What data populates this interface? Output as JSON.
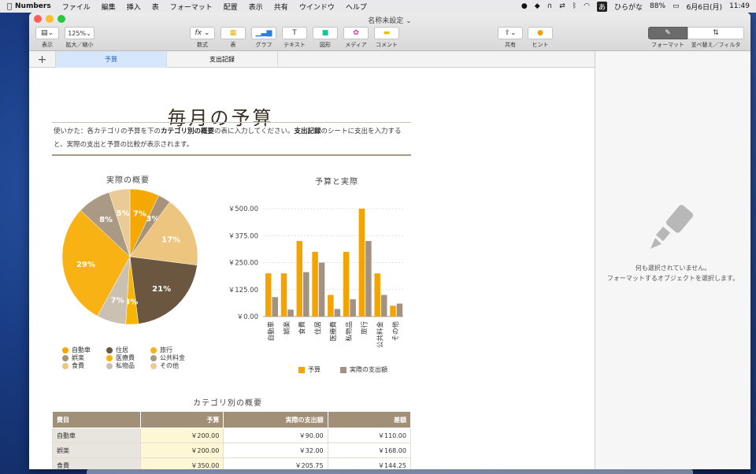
{
  "menubar": {
    "app": "Numbers",
    "items": [
      "ファイル",
      "編集",
      "挿入",
      "表",
      "フォーマット",
      "配置",
      "表示",
      "共有",
      "ウインドウ",
      "ヘルプ"
    ],
    "input_mode": "ひらがな",
    "battery": "88%",
    "date": "6月6日(月)",
    "time": "11:49"
  },
  "window": {
    "title": "名称未設定",
    "toolbar": {
      "view_label": "表示",
      "zoom_value": "125%",
      "zoom_label": "拡大／縮小",
      "formula_label": "数式",
      "table_label": "表",
      "chart_label": "グラフ",
      "text_label": "テキスト",
      "shape_label": "図形",
      "media_label": "メディア",
      "comment_label": "コメント",
      "share_label": "共有",
      "hint_label": "ヒント",
      "format_label": "フォーマット",
      "sort_label": "並べ替え／フィルタ"
    },
    "tabs": [
      "予算",
      "支出記録"
    ],
    "active_tab": "予算"
  },
  "sheet": {
    "title": "毎月の予算",
    "intro_1": "使いかた：各カテゴリの予算を下の",
    "intro_2": "カテゴリ別の概要",
    "intro_3": "の表に入力してください。",
    "intro_4": "支出記録",
    "intro_5": "のシートに支出を入力すると、実際の支出と予算の比較が表示されます。",
    "table_title": "カテゴリ別の概要",
    "table_headers": [
      "費目",
      "予算",
      "実際の支出額",
      "差額"
    ],
    "rows": [
      {
        "cat": "自動車",
        "budget": "￥200.00",
        "actual": "￥90.00",
        "diff": "￥110.00"
      },
      {
        "cat": "娯楽",
        "budget": "￥200.00",
        "actual": "￥32.00",
        "diff": "￥168.00"
      },
      {
        "cat": "食費",
        "budget": "￥350.00",
        "actual": "￥205.75",
        "diff": "￥144.25"
      }
    ]
  },
  "chart_data": [
    {
      "type": "pie",
      "title": "実際の概要",
      "categories": [
        "自動車",
        "娯楽",
        "食費",
        "住居",
        "医療費",
        "私物品",
        "旅行",
        "公共料金",
        "その他"
      ],
      "values": [
        7,
        3,
        17,
        21,
        3,
        7,
        29,
        8,
        5
      ],
      "labels": [
        "7%",
        "3%",
        "17%",
        "21%",
        "3%",
        "7%",
        "29%",
        "8%",
        "5%"
      ],
      "colors": [
        "#f5a800",
        "#a7927a",
        "#edc57e",
        "#6b5640",
        "#f7b500",
        "#cbc1b3",
        "#f9b214",
        "#ab9a83",
        "#eacb95"
      ],
      "legend_position": "bottom"
    },
    {
      "type": "bar",
      "title": "予算と実際",
      "categories": [
        "自動車",
        "娯楽",
        "食費",
        "住居",
        "医療費",
        "私物品",
        "旅行",
        "公共料金",
        "その他"
      ],
      "series": [
        {
          "name": "予算",
          "values": [
            200,
            200,
            350,
            300,
            100,
            300,
            500,
            200,
            50
          ],
          "color": "#f5a300"
        },
        {
          "name": "実際の支出額",
          "values": [
            90,
            32,
            205.75,
            250,
            35,
            80,
            350,
            100,
            60
          ],
          "color": "#a49181"
        }
      ],
      "ylim": [
        0,
        500
      ],
      "yticks": [
        "￥0.00",
        "￥125.00",
        "￥250.00",
        "￥375.00",
        "￥500.00"
      ],
      "grid": true,
      "legend_position": "bottom"
    }
  ],
  "sidebar": {
    "empty_title": "何も選択されていません。",
    "empty_sub": "フォーマットするオブジェクトを選択します。"
  }
}
